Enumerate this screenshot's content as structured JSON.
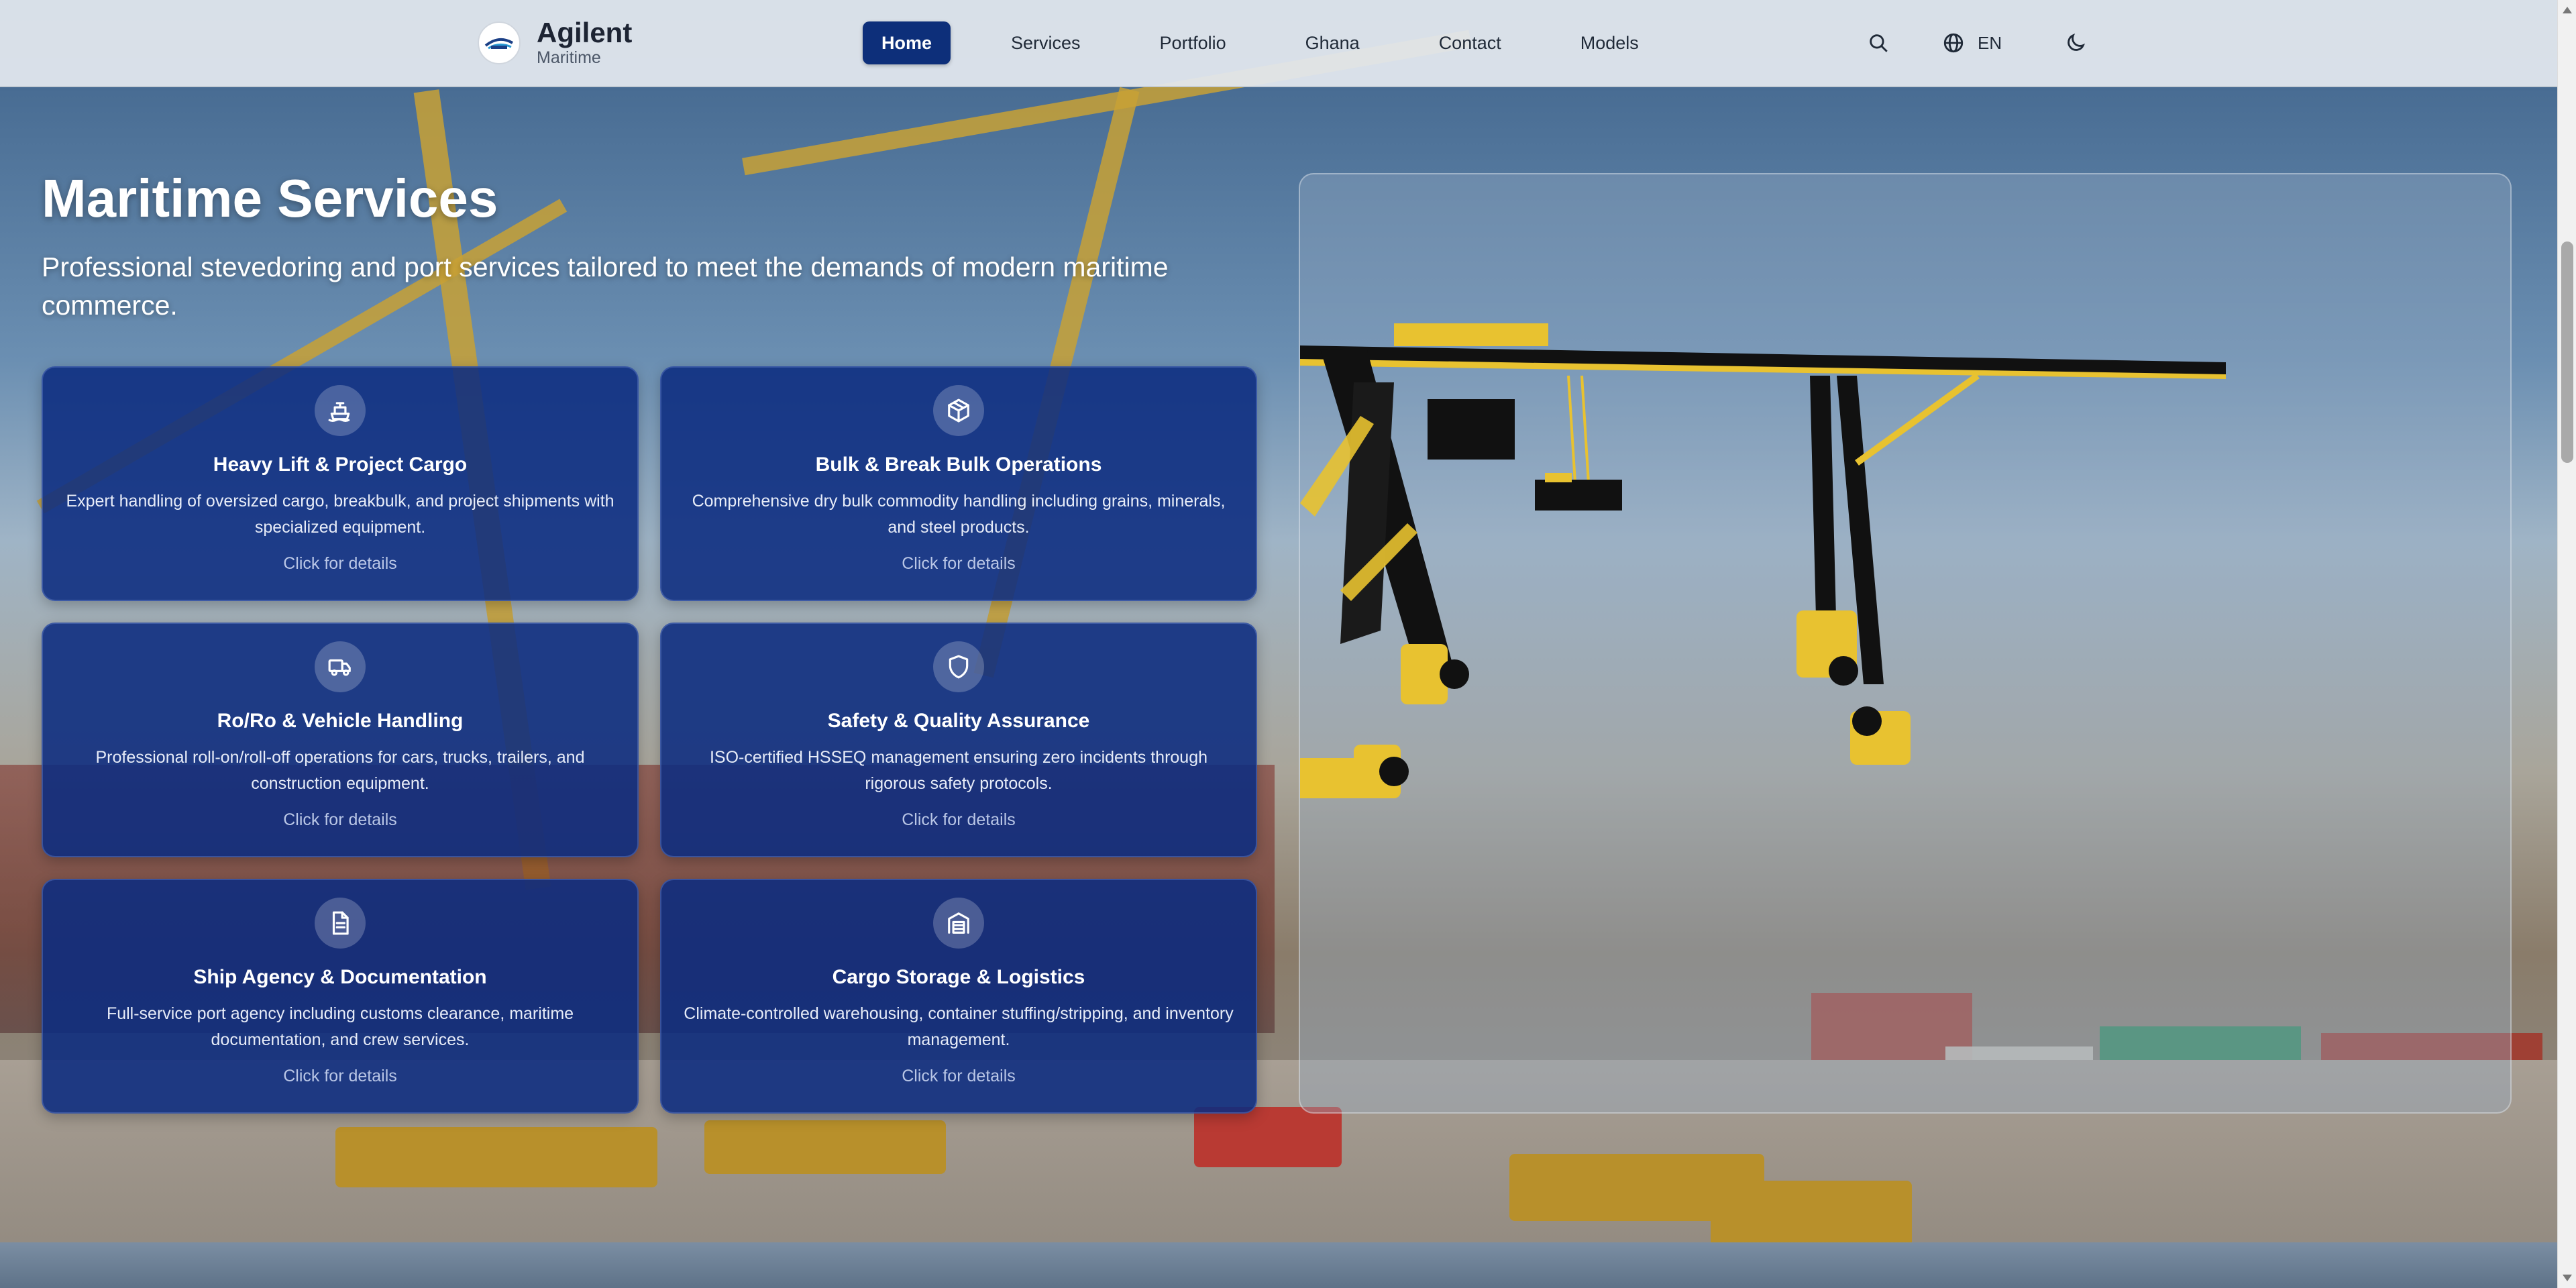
{
  "brand": {
    "name": "Agilent",
    "subtitle": "Maritime"
  },
  "nav": {
    "items": [
      {
        "label": "Home",
        "active": true
      },
      {
        "label": "Services",
        "active": false
      },
      {
        "label": "Portfolio",
        "active": false
      },
      {
        "label": "Ghana",
        "active": false
      },
      {
        "label": "Contact",
        "active": false
      },
      {
        "label": "Models",
        "active": false
      }
    ]
  },
  "header_icons": {
    "search": "search-icon",
    "language": "globe-icon",
    "language_label": "EN",
    "theme": "moon-icon"
  },
  "hero": {
    "title": "Maritime Services",
    "subtitle": "Professional stevedoring and port services tailored to meet the demands of modern maritime commerce."
  },
  "cards": [
    {
      "icon": "ship-icon",
      "title": "Heavy Lift & Project Cargo",
      "description": "Expert handling of oversized cargo, breakbulk, and project shipments with specialized equipment.",
      "cta": "Click for details"
    },
    {
      "icon": "package-icon",
      "title": "Bulk & Break Bulk Operations",
      "description": "Comprehensive dry bulk commodity handling including grains, minerals, and steel products.",
      "cta": "Click for details"
    },
    {
      "icon": "truck-icon",
      "title": "Ro/Ro & Vehicle Handling",
      "description": "Professional roll-on/roll-off operations for cars, trucks, trailers, and construction equipment.",
      "cta": "Click for details"
    },
    {
      "icon": "shield-icon",
      "title": "Safety & Quality Assurance",
      "description": "ISO-certified HSSEQ management ensuring zero incidents through rigorous safety protocols.",
      "cta": "Click for details"
    },
    {
      "icon": "document-icon",
      "title": "Ship Agency & Documentation",
      "description": "Full-service port agency including customs clearance, maritime documentation, and crew services.",
      "cta": "Click for details"
    },
    {
      "icon": "warehouse-icon",
      "title": "Cargo Storage & Logistics",
      "description": "Climate-controlled warehousing, container stuffing/stripping, and inventory management.",
      "cta": "Click for details"
    }
  ],
  "colors": {
    "nav_active": "#0d2f7a",
    "card_bg": "#0b2b80",
    "crane_yellow": "#f2c230"
  }
}
